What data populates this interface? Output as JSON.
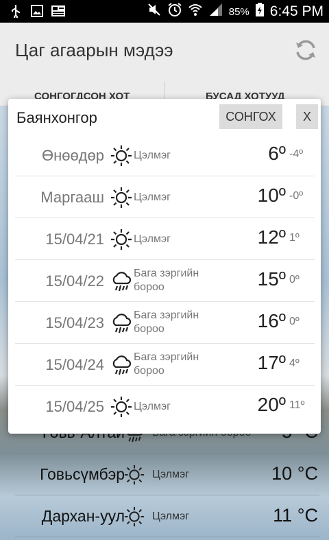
{
  "status_bar": {
    "battery": "85%",
    "time": "6:45 PM",
    "icons": [
      "usb-icon",
      "image-icon",
      "news-icon",
      "mute-icon",
      "alarm-icon",
      "wifi-icon",
      "signal-icon",
      "battery-charging-icon"
    ]
  },
  "app": {
    "title": "Цаг агаарын мэдээ",
    "refresh_icon": "refresh-icon"
  },
  "tabs": [
    {
      "label": "СОНГОГДСОН ХОТ"
    },
    {
      "label": "БУСАД ХОТУУД"
    }
  ],
  "background_rows": [
    {
      "name": "Говь-Алтай",
      "desc": "Бага зэргийн бороо",
      "temp": "5 °C",
      "icon": "rain-icon"
    },
    {
      "name": "Говьсүмбэр",
      "desc": "Цэлмэг",
      "temp": "10 °C",
      "icon": "sun-icon"
    },
    {
      "name": "Дархан-уул",
      "desc": "Цэлмэг",
      "temp": "11 °C",
      "icon": "sun-icon"
    }
  ],
  "dialog": {
    "title": "Баянхонгор",
    "select_label": "СОНГОХ",
    "close_label": "X",
    "days": [
      {
        "date": "Өнөөдөр",
        "icon": "sun-icon",
        "desc": "Цэлмэг",
        "high": "6º",
        "low": "-4º"
      },
      {
        "date": "Маргааш",
        "icon": "sun-icon",
        "desc": "Цэлмэг",
        "high": "10º",
        "low": "-0º"
      },
      {
        "date": "15/04/21",
        "icon": "sun-icon",
        "desc": "Цэлмэг",
        "high": "12º",
        "low": "1º"
      },
      {
        "date": "15/04/22",
        "icon": "rain-icon",
        "desc": "Бага зэргийн бороо",
        "high": "15º",
        "low": "0º"
      },
      {
        "date": "15/04/23",
        "icon": "rain-icon",
        "desc": "Бага зэргийн бороо",
        "high": "16º",
        "low": "0º"
      },
      {
        "date": "15/04/24",
        "icon": "rain-icon",
        "desc": "Бага зэргийн бороо",
        "high": "17º",
        "low": "4º"
      },
      {
        "date": "15/04/25",
        "icon": "sun-icon",
        "desc": "Цэлмэг",
        "high": "20º",
        "low": "11º"
      }
    ]
  }
}
